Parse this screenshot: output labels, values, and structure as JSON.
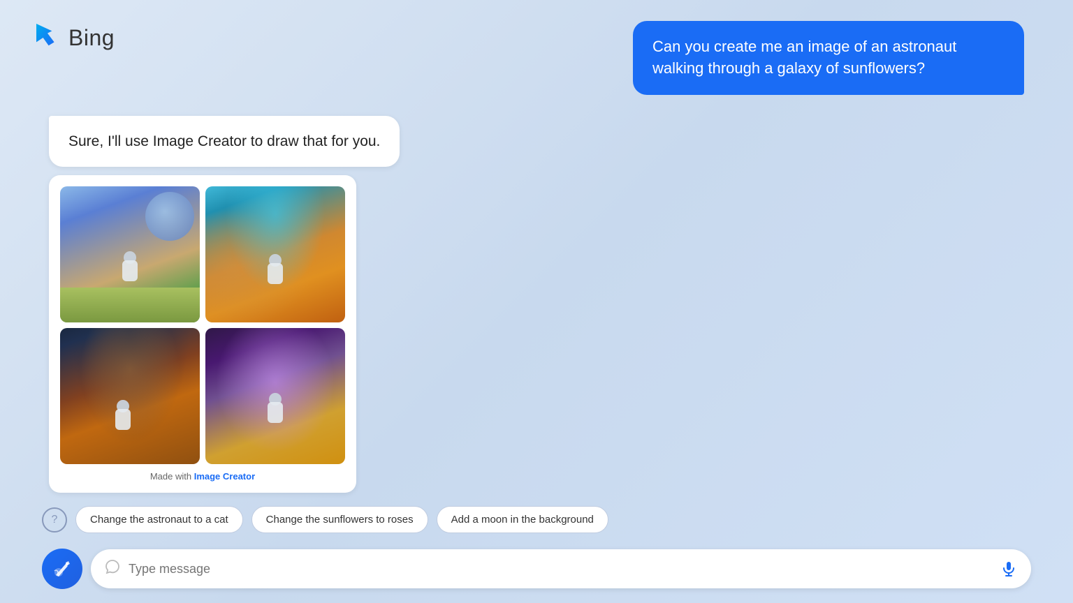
{
  "header": {
    "logo_text": "Bing",
    "logo_alt": "Bing logo"
  },
  "chat": {
    "user_message": "Can you create me an image of an astronaut walking through a galaxy of sunflowers?",
    "bot_text": "Sure, I'll use Image Creator to draw that for you.",
    "made_with_prefix": "Made with ",
    "made_with_link": "Image Creator"
  },
  "suggestions": {
    "help_tooltip": "Help",
    "buttons": [
      {
        "id": "change-astronaut",
        "label": "Change the astronaut to a cat"
      },
      {
        "id": "change-sunflowers",
        "label": "Change the sunflowers to roses"
      },
      {
        "id": "add-moon",
        "label": "Add a moon in the background"
      }
    ]
  },
  "input": {
    "placeholder": "Type message",
    "broom_label": "New conversation",
    "mic_label": "Voice input"
  },
  "images": {
    "grid_alt": "AI generated astronaut in galaxy with sunflowers",
    "count": 4
  }
}
